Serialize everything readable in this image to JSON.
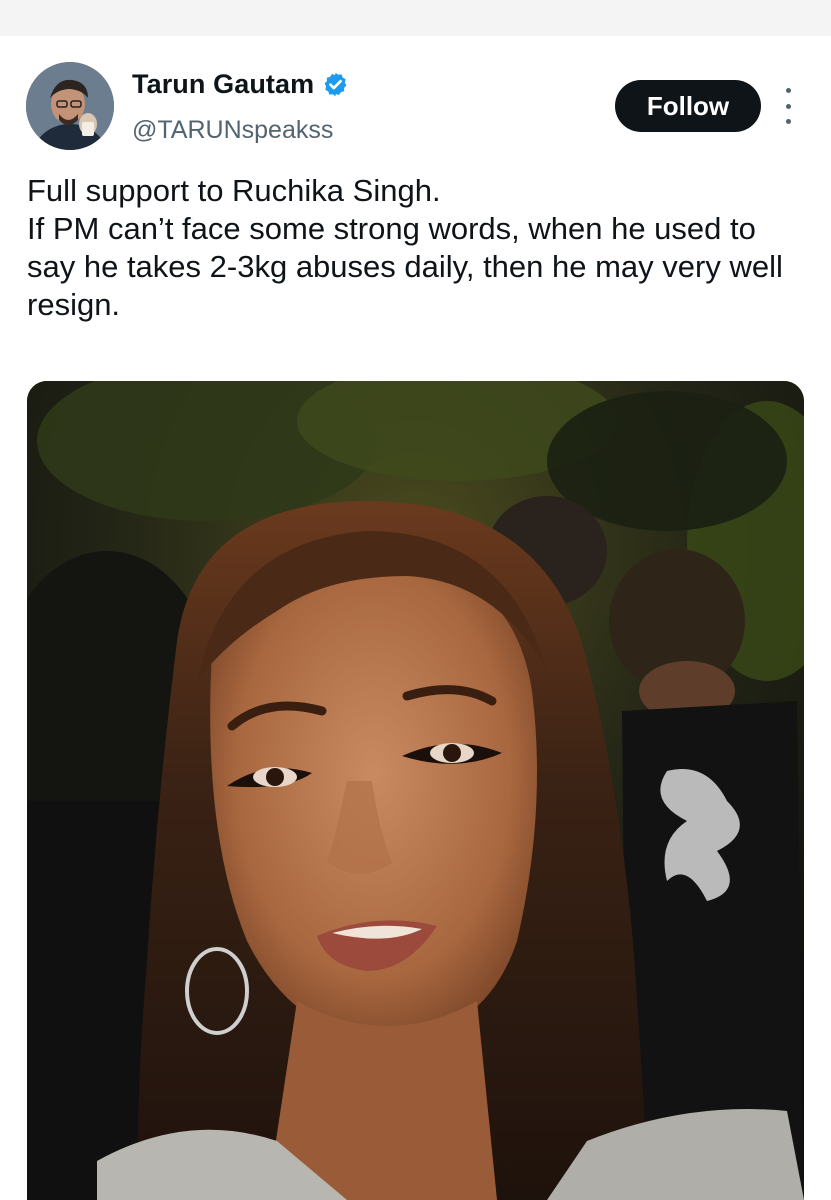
{
  "tweet": {
    "author": {
      "display_name": "Tarun Gautam",
      "handle": "@TARUNspeakss",
      "verified": true,
      "avatar_icon": "profile-photo"
    },
    "follow_label": "Follow",
    "more_icon": "more-options-icon",
    "text_lines": [
      "Full support to Ruchika Singh.",
      "If PM can’t face some strong words, when he used to say he takes 2-3kg abuses daily, then he may very well resign."
    ],
    "media": {
      "type": "video-thumbnail",
      "description_icon": "media-photo"
    }
  },
  "colors": {
    "verified_blue": "#1d9bf0",
    "follow_bg": "#0f1419",
    "handle_gray": "#536471"
  }
}
